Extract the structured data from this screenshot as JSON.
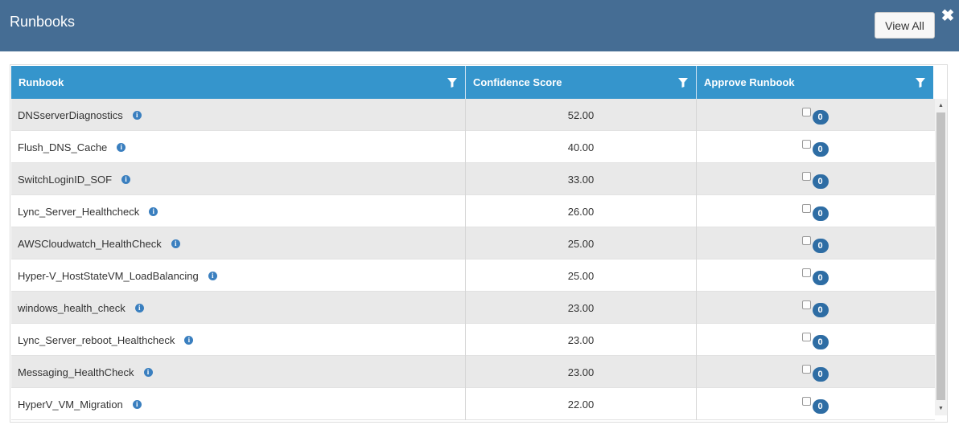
{
  "header": {
    "title": "Runbooks",
    "view_all_label": "View All",
    "close_glyph": "✖"
  },
  "table": {
    "columns": [
      {
        "label": "Runbook"
      },
      {
        "label": "Confidence Score"
      },
      {
        "label": "Approve Runbook"
      }
    ],
    "rows": [
      {
        "runbook": "DNSserverDiagnostics",
        "score": "52.00",
        "approvals": "0"
      },
      {
        "runbook": "Flush_DNS_Cache",
        "score": "40.00",
        "approvals": "0"
      },
      {
        "runbook": "SwitchLoginID_SOF",
        "score": "33.00",
        "approvals": "0"
      },
      {
        "runbook": "Lync_Server_Healthcheck",
        "score": "26.00",
        "approvals": "0"
      },
      {
        "runbook": "AWSCloudwatch_HealthCheck",
        "score": "25.00",
        "approvals": "0"
      },
      {
        "runbook": "Hyper-V_HostStateVM_LoadBalancing",
        "score": "25.00",
        "approvals": "0"
      },
      {
        "runbook": "windows_health_check",
        "score": "23.00",
        "approvals": "0"
      },
      {
        "runbook": "Lync_Server_reboot_Healthcheck",
        "score": "23.00",
        "approvals": "0"
      },
      {
        "runbook": "Messaging_HealthCheck",
        "score": "23.00",
        "approvals": "0"
      },
      {
        "runbook": "HyperV_VM_Migration",
        "score": "22.00",
        "approvals": "0"
      }
    ]
  },
  "icons": {
    "filter": "filter-icon",
    "info": "info-icon",
    "close": "close-icon"
  },
  "colors": {
    "header_bg": "#456d94",
    "table_header_bg": "#3595cc",
    "badge_bg": "#2e6da4",
    "alt_row_bg": "#e9e9e9"
  }
}
